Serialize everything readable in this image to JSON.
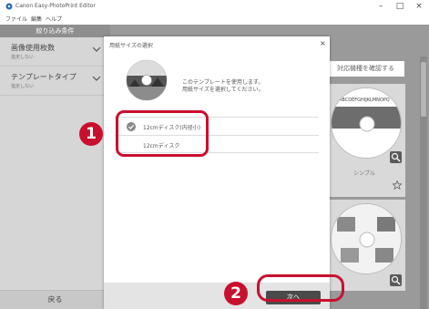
{
  "window": {
    "title": "Canon Easy-PhotoPrint Editor",
    "controls": {
      "minimize": "–",
      "maximize": "□",
      "close": "×"
    }
  },
  "menu": {
    "items": [
      "ファイル",
      "編集",
      "ヘルプ"
    ]
  },
  "left_panel": {
    "header": "絞り込み条件",
    "filters": [
      {
        "title": "画像使用枚数",
        "value": "指定しない"
      },
      {
        "title": "テンプレートタイプ",
        "value": "指定しない"
      }
    ],
    "back_label": "戻る"
  },
  "main": {
    "check_button_label": "対応機種を確認する",
    "template_name": "シンプル",
    "template_disc_text": "ABCDEFGHIJKLMNOPQ"
  },
  "dialog": {
    "title": "用紙サイズの選択",
    "message_lines": [
      "このテンプレートを使用します。",
      "用紙サイズを選択してください。"
    ],
    "options": [
      {
        "label": "12cmディスク(内径小)",
        "selected": true
      },
      {
        "label": "12cmディスク",
        "selected": false
      }
    ],
    "next_label": "次へ"
  },
  "annotations": {
    "step1": "1",
    "step2": "2",
    "highlight_color": "#c8102e"
  },
  "colors": {
    "left_panel": "#d6d6d6",
    "main_background": "#9a9a9a",
    "next_button": "#4a4a4a"
  },
  "icons": [
    "app-icon",
    "minimize-icon",
    "maximize-icon",
    "close-icon",
    "chevron-down-icon",
    "disc-icon",
    "check-circle-icon",
    "zoom-icon",
    "star-icon"
  ]
}
